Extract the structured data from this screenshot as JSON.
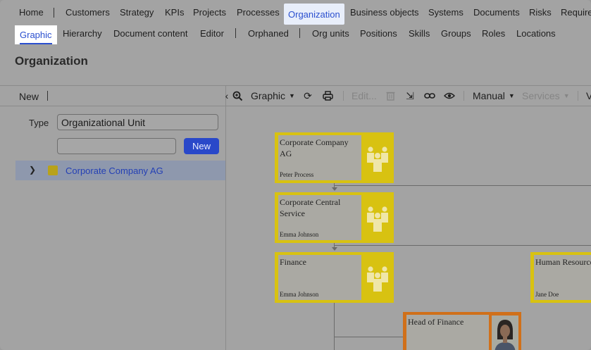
{
  "nav_primary": [
    {
      "label": "Home"
    },
    {
      "label": "Customers"
    },
    {
      "label": "Strategy"
    },
    {
      "label": "KPIs"
    },
    {
      "label": "Projects"
    },
    {
      "label": "Processes"
    },
    {
      "label": "Organization",
      "active": true
    },
    {
      "label": "Business objects"
    },
    {
      "label": "Systems"
    },
    {
      "label": "Documents"
    },
    {
      "label": "Risks"
    },
    {
      "label": "Require"
    }
  ],
  "nav_secondary": [
    {
      "label": "Graphic",
      "active": true
    },
    {
      "label": "Hierarchy"
    },
    {
      "label": "Document content"
    },
    {
      "label": "Editor"
    },
    {
      "label": "Orphaned"
    },
    {
      "label": "Org units"
    },
    {
      "label": "Positions"
    },
    {
      "label": "Skills"
    },
    {
      "label": "Groups"
    },
    {
      "label": "Roles"
    },
    {
      "label": "Locations"
    }
  ],
  "page": {
    "title": "Organization"
  },
  "left_panel": {
    "new_label": "New",
    "type_label": "Type",
    "type_value": "Organizational Unit",
    "search_value": "",
    "new_button": "New",
    "tree": [
      {
        "label": "Corporate Company AG",
        "color": "#b8a21b"
      }
    ]
  },
  "toolbar": {
    "collapse_icon": "chevron-left-icon",
    "zoom_icon": "zoom-in-icon",
    "view_label": "Graphic",
    "edit_label": "Edit...",
    "layout_label": "Manual",
    "services_label": "Services"
  },
  "diagram": {
    "nodes": [
      {
        "name": "Corporate Company AG",
        "person": "Peter Process",
        "color": "#d8c211"
      },
      {
        "name": "Corporate Central Service",
        "person": "Emma Johnson",
        "color": "#d8c211"
      },
      {
        "name": "Finance",
        "person": "Emma Johnson",
        "color": "#d8c211"
      },
      {
        "name": "Human Resource",
        "person": "Jane Doe",
        "color": "#d8c211"
      },
      {
        "name": "Head of Finance",
        "person": "",
        "color": "#d0701a"
      }
    ]
  },
  "colors": {
    "accent": "#2a4fcf",
    "org_unit": "#d8c211",
    "position": "#d0701a",
    "selected_row": "#8e98ad"
  }
}
